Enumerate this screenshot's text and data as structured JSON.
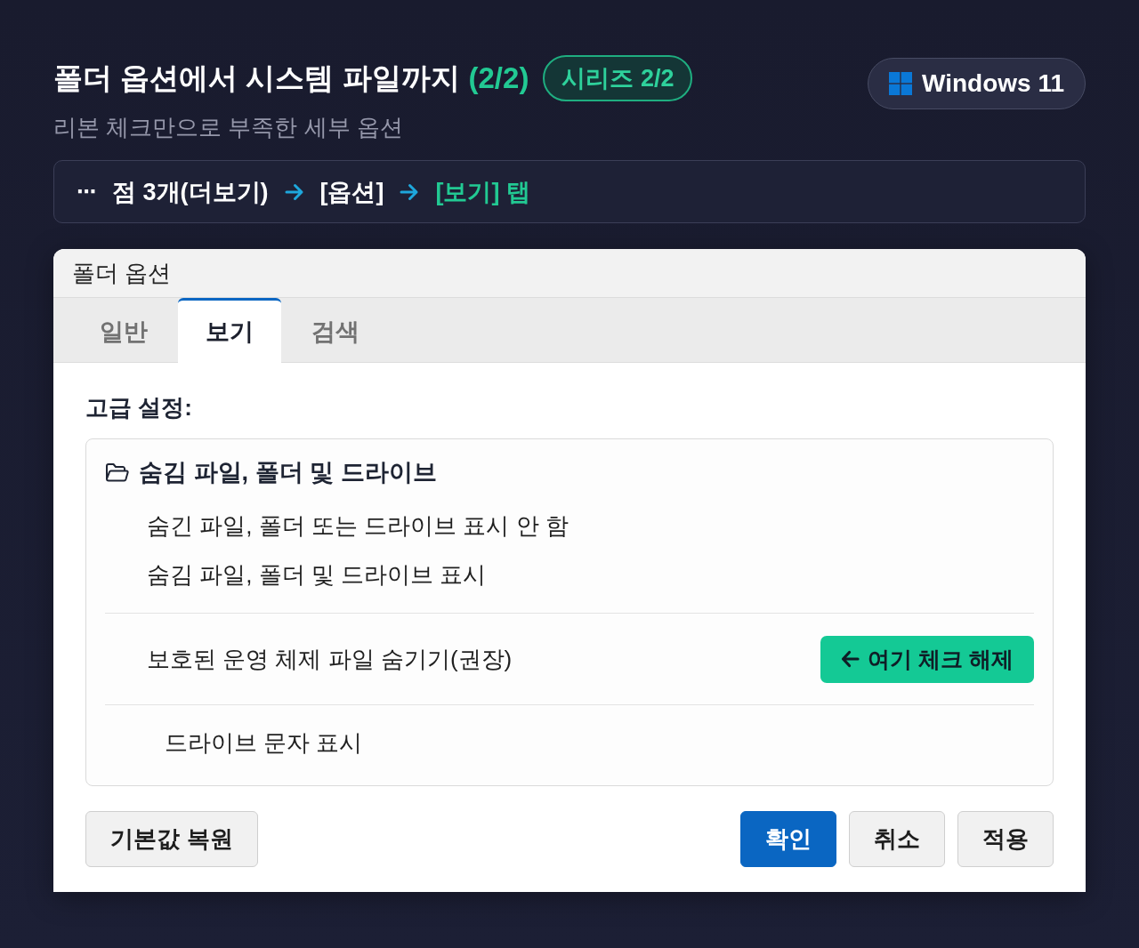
{
  "header": {
    "title": "폴더 옵션에서 시스템 파일까지",
    "title_count": "(2/2)",
    "series_badge": "시리즈 2/2",
    "subtitle": "리본 체크만으로 부족한 세부 옵션",
    "platform_badge": "Windows 11"
  },
  "breadcrumb": {
    "more_glyph": "⋯",
    "steps": [
      {
        "label": "점 3개(더보기)",
        "current": false
      },
      {
        "label": "[옵션]",
        "current": false
      },
      {
        "label": "[보기] 탭",
        "current": true
      }
    ]
  },
  "dialog": {
    "title": "폴더 옵션",
    "tabs": [
      {
        "label": "일반",
        "selected": false
      },
      {
        "label": "보기",
        "selected": true
      },
      {
        "label": "검색",
        "selected": false
      }
    ],
    "section_label": "고급 설정:",
    "settings": [
      {
        "kind": "group",
        "label": "숨김 파일, 폴더 및 드라이브",
        "children": [
          {
            "label": "숨긴 파일, 폴더 또는 드라이브 표시 안 함"
          },
          {
            "label": "숨김 파일, 폴더 및 드라이브 표시"
          }
        ]
      },
      {
        "kind": "callout_option",
        "label": "보호된 운영 체제 파일 숨기기(권장)",
        "callout": "여기 체크 해제"
      },
      {
        "kind": "option",
        "label": "드라이브 문자 표시"
      }
    ],
    "reset_button": "기본값 복원",
    "buttons": [
      {
        "label": "확인",
        "kind": "primary"
      },
      {
        "label": "취소",
        "kind": "default"
      },
      {
        "label": "적용",
        "kind": "default"
      }
    ]
  }
}
